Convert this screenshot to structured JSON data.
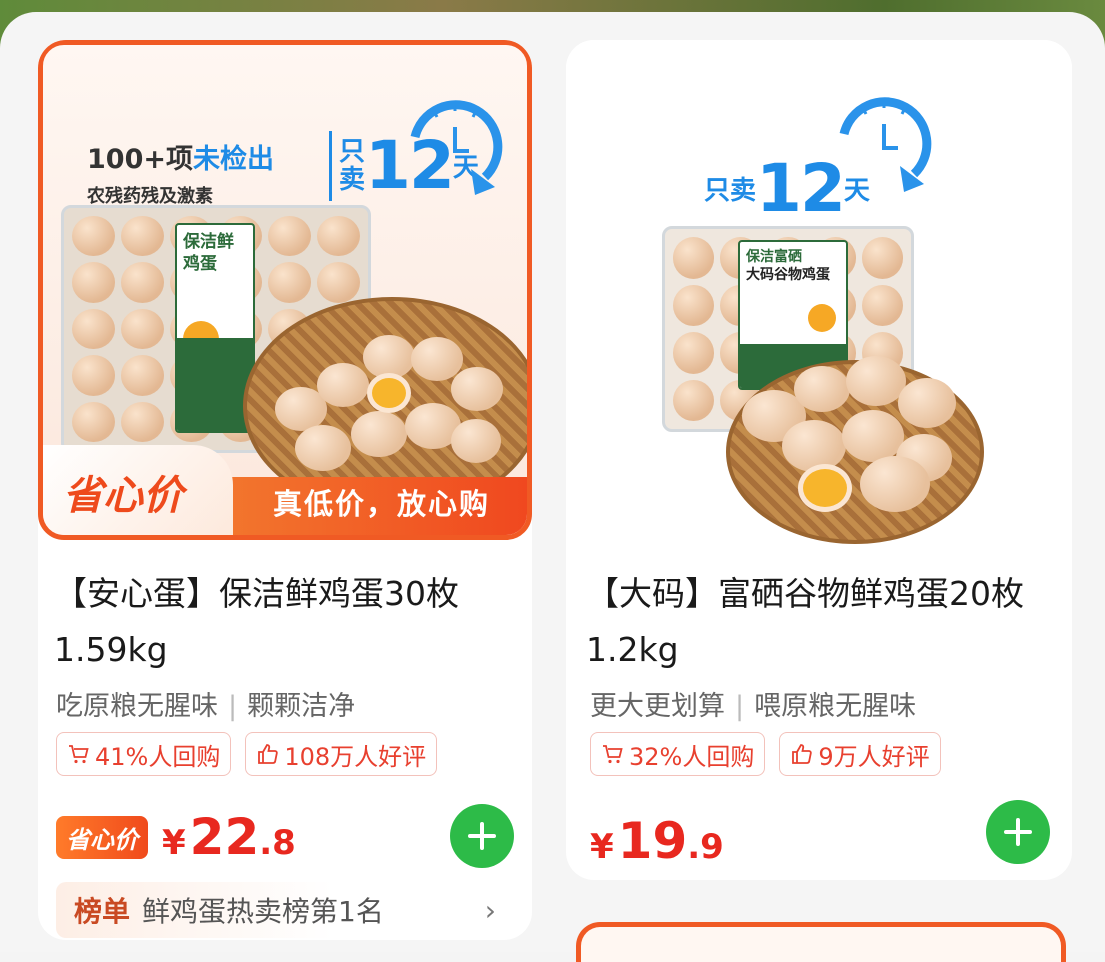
{
  "products": [
    {
      "promo_main_dark": "100+项",
      "promo_main_blue": "未检出",
      "promo_sub": "农残药残及激素",
      "only_sell_small": "只",
      "only_sell_small2": "卖",
      "only_sell_num": "12",
      "only_sell_unit": "天",
      "package_label": "保洁鲜鸡蛋",
      "banner_tag": "省心价",
      "banner_slogan": "真低价，放心购",
      "title_line1": "【安心蛋】保洁鲜鸡蛋30枚",
      "title_line2": "1.59kg",
      "feature1": "吃原粮无腥味",
      "feature2": "颗颗洁净",
      "repurchase": "41%人回购",
      "reviews": "108万人好评",
      "price_tag": "省心价",
      "currency": "¥",
      "price_int": "22",
      "price_dec": ".8",
      "rank_label": "榜单",
      "rank_text": "鲜鸡蛋热卖榜第1名",
      "rank_arrow": "›"
    },
    {
      "only_sell_small": "只卖",
      "only_sell_num": "12",
      "only_sell_unit": "天",
      "package_label_top": "保洁富硒",
      "package_label": "大码谷物鸡蛋",
      "title_line1": "【大码】富硒谷物鲜鸡蛋20枚",
      "title_line2": "1.2kg",
      "feature1": "更大更划算",
      "feature2": "喂原粮无腥味",
      "repurchase": "32%人回购",
      "reviews": "9万人好评",
      "currency": "¥",
      "price_int": "19",
      "price_dec": ".9"
    }
  ],
  "colors": {
    "accent_orange": "#f05a24",
    "price_red": "#e8281f",
    "add_green": "#2dbb48",
    "promo_blue": "#1e8be6"
  },
  "icons": [
    "cart-icon",
    "thumbs-up-icon",
    "plus-icon",
    "clock-icon",
    "chevron-right-icon"
  ]
}
